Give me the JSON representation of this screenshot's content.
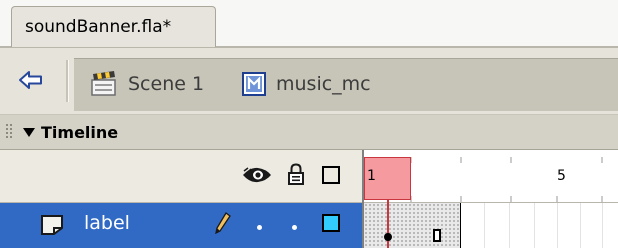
{
  "tab": {
    "document_name": "soundBanner.fla*"
  },
  "editbar": {
    "back_icon": "back-arrow-icon",
    "breadcrumbs": [
      {
        "label": "Scene 1",
        "icon": "clapper-scene-icon"
      },
      {
        "label": "music_mc",
        "icon": "movieclip-symbol-icon"
      }
    ]
  },
  "timeline": {
    "title": "Timeline",
    "column_icons": [
      "eye-icon",
      "lock-icon",
      "outline-icon"
    ],
    "frame_numbers": [
      "1",
      "5"
    ],
    "current_frame": 1,
    "layers": [
      {
        "name": "label",
        "selected": true,
        "icon": "label-layer-icon",
        "color": "#33ccff"
      }
    ]
  },
  "colors": {
    "selection": "#316ac5",
    "playhead": "#f59a9f",
    "playhead_line": "#c9363e",
    "layer_swatch": "#33ccff"
  }
}
